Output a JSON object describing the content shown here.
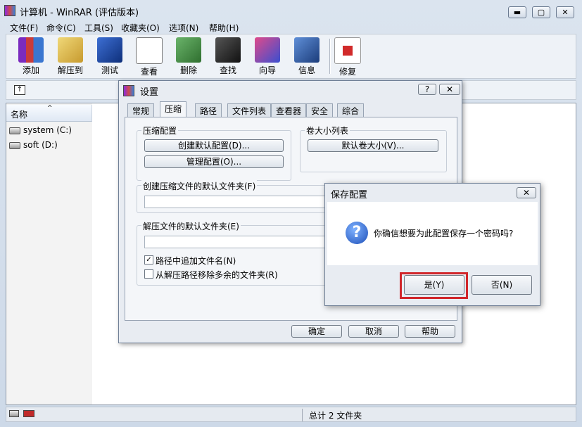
{
  "window": {
    "title": "计算机 - WinRAR (评估版本)",
    "controls": {
      "minimize": "▬",
      "maximize": "▢",
      "close": "✕"
    }
  },
  "menu": [
    "文件(F)",
    "命令(C)",
    "工具(S)",
    "收藏夹(O)",
    "选项(N)",
    "帮助(H)"
  ],
  "toolbar": [
    {
      "label": "添加",
      "icon": "add-archive-icon"
    },
    {
      "label": "解压到",
      "icon": "extract-to-icon"
    },
    {
      "label": "测试",
      "icon": "test-icon"
    },
    {
      "label": "查看",
      "icon": "view-icon"
    },
    {
      "label": "删除",
      "icon": "delete-icon"
    },
    {
      "label": "查找",
      "icon": "find-icon"
    },
    {
      "label": "向导",
      "icon": "wizard-icon"
    },
    {
      "label": "信息",
      "icon": "info-icon"
    },
    {
      "label": "修复",
      "icon": "repair-icon"
    }
  ],
  "filelist": {
    "column_name": "名称",
    "drives": [
      "system (C:)",
      "soft (D:)"
    ]
  },
  "status": {
    "text": "总计 2 文件夹"
  },
  "settings_dialog": {
    "title": "设置",
    "help": "?",
    "close": "✕",
    "tabs": [
      "常规",
      "压缩",
      "路径",
      "文件列表",
      "查看器",
      "安全",
      "综合"
    ],
    "active_tab": "压缩",
    "compression_group": "压缩配置",
    "create_default": "创建默认配置(D)...",
    "manage": "管理配置(O)...",
    "volume_group": "卷大小列表",
    "default_volume": "默认卷大小(V)...",
    "default_create_folder": "创建压缩文件的默认文件夹(F)",
    "default_extract_folder": "解压文件的默认文件夹(E)",
    "append_name": "路径中追加文件名(N)",
    "remove_redundant": "从解压路径移除多余的文件夹(R)",
    "ok": "确定",
    "cancel": "取消",
    "help_btn": "帮助"
  },
  "confirm_dialog": {
    "title": "保存配置",
    "close": "✕",
    "icon": "question-icon",
    "message": "你确信想要为此配置保存一个密码吗?",
    "yes": "是(Y)",
    "no": "否(N)"
  },
  "colors": {
    "highlight": "#d1262b"
  }
}
